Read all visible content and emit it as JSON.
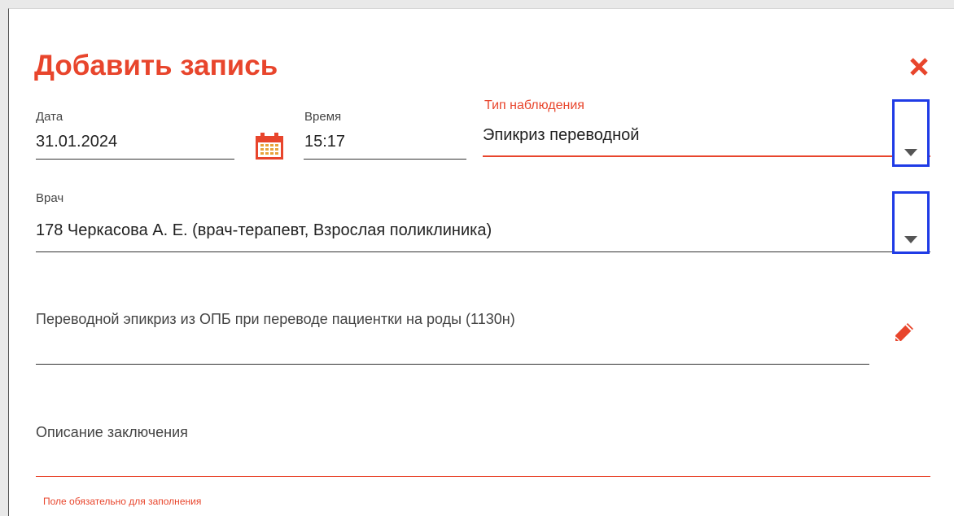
{
  "dialog": {
    "title": "Добавить запись",
    "close_icon": "close-icon",
    "accent_color": "#e8452c",
    "highlight_color": "#1f3be6"
  },
  "date": {
    "label": "Дата",
    "value": "31.01.2024",
    "icon": "calendar-icon"
  },
  "time": {
    "label": "Время",
    "value": "15:17"
  },
  "observation_type": {
    "label": "Тип наблюдения",
    "value": "Эпикриз переводной",
    "icon": "chevron-down-icon"
  },
  "doctor": {
    "label": "Врач",
    "value": "178 Черкасова А. Е.  (врач-терапевт, Взрослая поликлиника)",
    "icon": "chevron-down-icon"
  },
  "template": {
    "text": "Переводной эпикриз из ОПБ при переводе пациентки на роды (1130н)",
    "icon": "pencil-icon"
  },
  "conclusion": {
    "placeholder": "Описание заключения",
    "error": "Поле обязательно для заполнения"
  }
}
